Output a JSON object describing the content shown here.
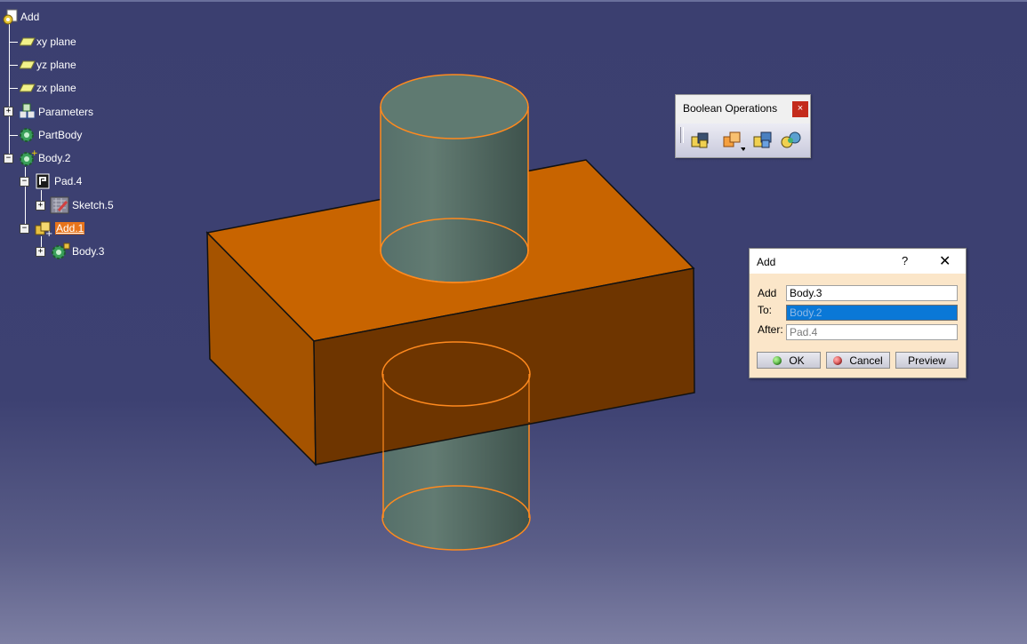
{
  "tree": {
    "root": "Add",
    "items": [
      {
        "label": "xy plane"
      },
      {
        "label": "yz plane"
      },
      {
        "label": "zx plane"
      },
      {
        "label": "Parameters"
      },
      {
        "label": "PartBody"
      },
      {
        "label": "Body.2"
      },
      {
        "label": "Pad.4"
      },
      {
        "label": "Sketch.5"
      },
      {
        "label": "Add.1"
      },
      {
        "label": "Body.3"
      }
    ],
    "expand_plus": "+",
    "expand_minus": "−"
  },
  "toolbar": {
    "title": "Boolean Operations",
    "close": "×",
    "buttons": [
      {
        "icon": "assemble-icon"
      },
      {
        "icon": "add-icon"
      },
      {
        "icon": "remove-icon"
      },
      {
        "icon": "intersect-icon"
      }
    ]
  },
  "dialog": {
    "title": "Add",
    "help": "?",
    "close": "✕",
    "add_label": "Add",
    "add_value": "Body.3",
    "to_label": "To:",
    "to_value": "Body.2",
    "after_label": "After:",
    "after_value": "Pad.4",
    "ok_label": "OK",
    "cancel_label": "Cancel",
    "preview_label": "Preview"
  },
  "colors": {
    "background": "#3d4172",
    "box_top": "#c86400",
    "box_front": "#6e3500",
    "box_side": "#a55300",
    "cylinder": "#5e7870",
    "highlight_edge": "#ff8a1e",
    "selection": "#e8741b"
  }
}
